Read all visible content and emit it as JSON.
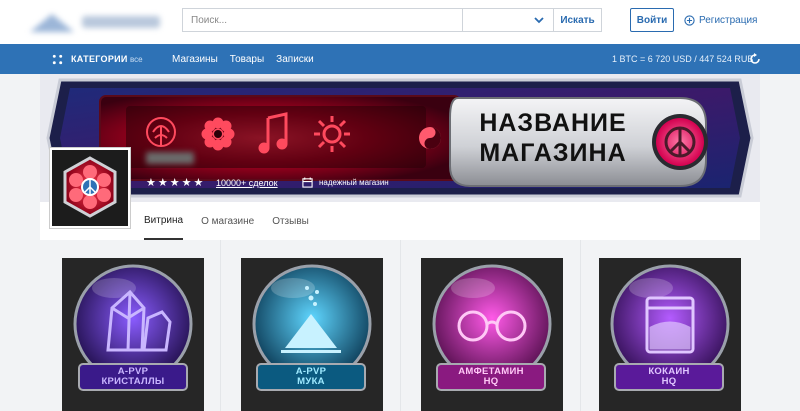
{
  "header": {
    "search_placeholder": "Поиск...",
    "search_button": "Искать",
    "login_button": "Войти",
    "register_link": "Регистрация"
  },
  "nav": {
    "categories_label": "КАТЕГОРИИ",
    "categories_all": "все",
    "links": [
      "Магазины",
      "Товары",
      "Записки"
    ],
    "rate": "1 BTC = 6 720 USD / 447 524 RUB"
  },
  "banner": {
    "title_line1": "НАЗВАНИЕ",
    "title_line2": "МАГАЗИНА"
  },
  "shop": {
    "rating_stars": 5,
    "deals_text": "10000+ сделок",
    "trust_text": "надежный магазин",
    "tabs": [
      {
        "label": "Витрина",
        "active": true
      },
      {
        "label": "О магазине",
        "active": false
      },
      {
        "label": "Отзывы",
        "active": false
      }
    ]
  },
  "products": [
    {
      "line1": "A-PVP",
      "line2": "КРИСТАЛЛЫ",
      "color": "#6b3cff",
      "icon": "crystals-icon"
    },
    {
      "line1": "A-PVP",
      "line2": "МУКА",
      "color": "#29b6e8",
      "icon": "powder-icon"
    },
    {
      "line1": "АМФЕТАМИН",
      "line2": "HQ",
      "color": "#e83ad6",
      "icon": "glasses-icon"
    },
    {
      "line1": "КОКАИН",
      "line2": "HQ",
      "color": "#a43cf0",
      "icon": "bag-icon"
    }
  ],
  "colors": {
    "brand_blue": "#2e72b6",
    "accent_red": "#e3163a"
  }
}
